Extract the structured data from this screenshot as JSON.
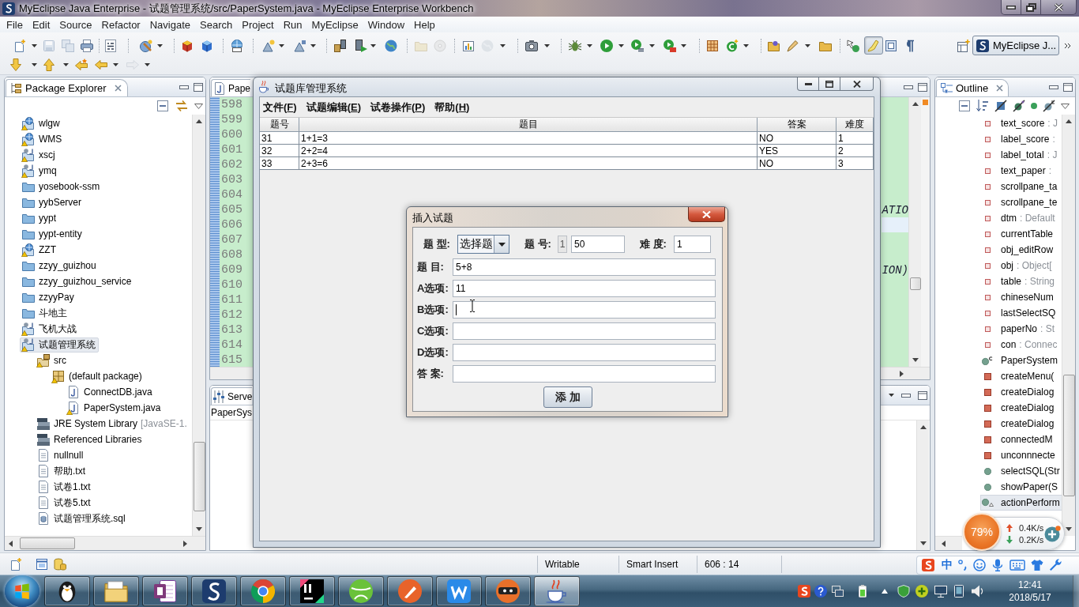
{
  "window": {
    "title": "MyEclipse Java Enterprise - 试题管理系统/src/PaperSystem.java - MyEclipse Enterprise Workbench"
  },
  "menu_bar": [
    "File",
    "Edit",
    "Source",
    "Refactor",
    "Navigate",
    "Search",
    "Project",
    "Run",
    "MyEclipse",
    "Window",
    "Help"
  ],
  "toolbar": {
    "toggle_button": {
      "on": true
    }
  },
  "perspective": {
    "label": "MyEclipse J...",
    "selected": true
  },
  "package_explorer": {
    "title": "Package Explorer",
    "items": [
      {
        "label": "wlgw",
        "kind": "web-project",
        "warning": true,
        "selected": false
      },
      {
        "label": "WMS",
        "kind": "web-project",
        "warning": true,
        "selected": false
      },
      {
        "label": "xscj",
        "kind": "java-project",
        "warning": true,
        "selected": false
      },
      {
        "label": "ymq",
        "kind": "java-project",
        "warning": true,
        "selected": false
      },
      {
        "label": "yosebook-ssm",
        "kind": "folder",
        "warning": false,
        "selected": false
      },
      {
        "label": "yybServer",
        "kind": "folder",
        "warning": false,
        "selected": false
      },
      {
        "label": "yypt",
        "kind": "folder",
        "warning": false,
        "selected": false
      },
      {
        "label": "yypt-entity",
        "kind": "folder",
        "warning": false,
        "selected": false
      },
      {
        "label": "ZZT",
        "kind": "web-project",
        "warning": true,
        "selected": false
      },
      {
        "label": "zzyy_guizhou",
        "kind": "folder",
        "warning": false,
        "selected": false
      },
      {
        "label": "zzyy_guizhou_service",
        "kind": "folder",
        "warning": false,
        "selected": false
      },
      {
        "label": "zzyyPay",
        "kind": "folder",
        "warning": false,
        "selected": false
      },
      {
        "label": "斗地主",
        "kind": "folder",
        "warning": false,
        "selected": false
      },
      {
        "label": "飞机大战",
        "kind": "java-project",
        "warning": true,
        "selected": false
      },
      {
        "label": "试题管理系统",
        "kind": "java-project",
        "warning": true,
        "selected": true,
        "children": [
          {
            "label": "src",
            "kind": "source-folder",
            "warning": true,
            "selected": false,
            "children": [
              {
                "label": "(default package)",
                "kind": "package",
                "warning": true,
                "selected": false,
                "children": [
                  {
                    "label": "ConnectDB.java",
                    "kind": "java-file",
                    "warning": false,
                    "selected": false
                  },
                  {
                    "label": "PaperSystem.java",
                    "kind": "java-file",
                    "warning": true,
                    "selected": false
                  }
                ]
              }
            ]
          },
          {
            "label": "JRE System Library",
            "detail": "[JavaSE-1.",
            "kind": "library",
            "warning": false,
            "selected": false
          },
          {
            "label": "Referenced Libraries",
            "kind": "library",
            "warning": false,
            "selected": false
          },
          {
            "label": "nullnull",
            "kind": "file",
            "warning": false,
            "selected": false
          },
          {
            "label": "帮助.txt",
            "kind": "file",
            "warning": false,
            "selected": false
          },
          {
            "label": "试卷1.txt",
            "kind": "file",
            "warning": false,
            "selected": false
          },
          {
            "label": "试卷5.txt",
            "kind": "file",
            "warning": false,
            "selected": false
          },
          {
            "label": "试题管理系统.sql",
            "kind": "database-file",
            "warning": false,
            "selected": false
          }
        ]
      }
    ]
  },
  "editor": {
    "tab": "Pape",
    "lines": [
      {
        "number": "598",
        "current": false
      },
      {
        "number": "599",
        "current": false
      },
      {
        "number": "600",
        "current": false
      },
      {
        "number": "601",
        "current": false
      },
      {
        "number": "602",
        "current": false
      },
      {
        "number": "603",
        "current": false
      },
      {
        "number": "604",
        "current": false
      },
      {
        "number": "605",
        "code": "ATIO",
        "current": false
      },
      {
        "number": "606",
        "current": true
      },
      {
        "number": "607",
        "current": false
      },
      {
        "number": "608",
        "current": false
      },
      {
        "number": "609",
        "code": "ION)",
        "current": false
      },
      {
        "number": "610",
        "current": false
      },
      {
        "number": "611",
        "current": false
      },
      {
        "number": "612",
        "current": false
      },
      {
        "number": "613",
        "current": false
      },
      {
        "number": "614",
        "current": false
      },
      {
        "number": "615",
        "current": false
      }
    ]
  },
  "servers_view": {
    "tab": "Serve",
    "entry": "PaperSys"
  },
  "app_window": {
    "title": "试题库管理系统",
    "menus": [
      "文件(F)",
      "试题编辑(E)",
      "试卷操作(P)",
      "帮助(H)"
    ],
    "table": {
      "columns": [
        "题号",
        "题目",
        "答案",
        "难度"
      ],
      "rows": [
        [
          "31",
          "1+1=3",
          "NO",
          "1"
        ],
        [
          "32",
          "2+2=4",
          "YES",
          "2"
        ],
        [
          "33",
          "2+3=6",
          "NO",
          "3"
        ]
      ]
    }
  },
  "dialog": {
    "title": "插入试题",
    "type": {
      "label": "题 型:",
      "value": "选择题"
    },
    "number": {
      "label": "题 号:",
      "prefix": "1",
      "value": "50"
    },
    "difficulty": {
      "label": "难 度:",
      "value": "1"
    },
    "fields": [
      {
        "label": "题 目:",
        "value": "5+8",
        "focused": false
      },
      {
        "label": "A选项:",
        "value": "11",
        "focused": false
      },
      {
        "label": "B选项:",
        "focused": true
      },
      {
        "label": "C选项:",
        "focused": false
      },
      {
        "label": "D选项:",
        "focused": false
      },
      {
        "label": "答 案:",
        "focused": false
      }
    ],
    "button": "添加"
  },
  "outline": {
    "title": "Outline",
    "items": [
      {
        "name": "text_score",
        "type": ": J",
        "kind": "field",
        "selected": false
      },
      {
        "name": "label_score",
        "type": ":",
        "kind": "field",
        "selected": false
      },
      {
        "name": "label_total",
        "type": ": J",
        "kind": "field",
        "selected": false
      },
      {
        "name": "text_paper",
        "type": ":",
        "kind": "field",
        "selected": false
      },
      {
        "name": "scrollpane_ta",
        "kind": "field",
        "selected": false
      },
      {
        "name": "scrollpane_te",
        "kind": "field",
        "selected": false
      },
      {
        "name": "dtm",
        "type": ": Default",
        "kind": "field",
        "selected": false
      },
      {
        "name": "currentTable",
        "kind": "field",
        "selected": false
      },
      {
        "name": "obj_editRow",
        "kind": "field",
        "selected": false
      },
      {
        "name": "obj",
        "type": ": Object[",
        "kind": "field",
        "selected": false
      },
      {
        "name": "table",
        "type": ": String",
        "kind": "field",
        "selected": false
      },
      {
        "name": "chineseNum",
        "kind": "field",
        "selected": false
      },
      {
        "name": "lastSelectSQ",
        "kind": "field",
        "selected": false
      },
      {
        "name": "paperNo",
        "type": ": St",
        "kind": "field",
        "selected": false
      },
      {
        "name": "con",
        "type": ": Connec",
        "kind": "field",
        "selected": false
      },
      {
        "name": "PaperSystem",
        "kind": "constructor",
        "selected": false
      },
      {
        "name": "createMenu(",
        "kind": "private-method",
        "selected": false
      },
      {
        "name": "createDialog",
        "kind": "private-method",
        "selected": false
      },
      {
        "name": "createDialog",
        "kind": "private-method",
        "selected": false
      },
      {
        "name": "createDialog",
        "kind": "private-method",
        "selected": false
      },
      {
        "name": "connectedM",
        "kind": "private-method",
        "selected": false
      },
      {
        "name": "unconnnecte",
        "kind": "private-method",
        "selected": false
      },
      {
        "name": "selectSQL(Str",
        "kind": "method",
        "selected": false
      },
      {
        "name": "showPaper(S",
        "kind": "method",
        "selected": false
      },
      {
        "name": "actionPerform",
        "kind": "override-method",
        "selected": true
      }
    ]
  },
  "status_bar": {
    "cells": [
      "Writable",
      "Smart Insert",
      "606 : 14"
    ]
  },
  "ime_bar": {
    "mode": "中"
  },
  "network_widget": {
    "usage": "79%",
    "upload": "0.4K/s",
    "download": "0.2K/s"
  },
  "taskbar": {
    "apps": [
      {
        "kind": "chat",
        "selected": false
      },
      {
        "kind": "files",
        "selected": false
      },
      {
        "kind": "notes",
        "selected": false
      },
      {
        "kind": "workbench",
        "selected": false
      },
      {
        "kind": "browser",
        "selected": false
      },
      {
        "kind": "editor",
        "selected": false
      },
      {
        "kind": "ball",
        "selected": false
      },
      {
        "kind": "feather",
        "selected": false
      },
      {
        "kind": "writer",
        "selected": false
      },
      {
        "kind": "mask",
        "selected": false
      },
      {
        "kind": "java",
        "selected": true
      }
    ],
    "clock": {
      "time": "12:41",
      "date": "2018/5/17"
    }
  }
}
